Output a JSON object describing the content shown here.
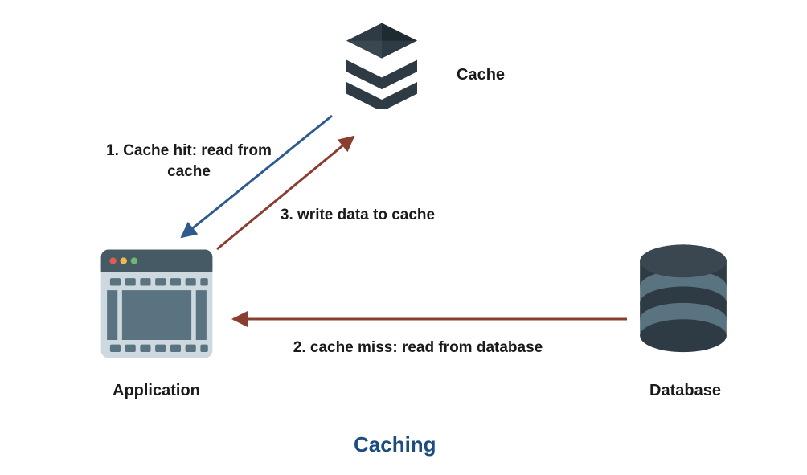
{
  "title": "Caching",
  "nodes": {
    "cache": {
      "label": "Cache"
    },
    "application": {
      "label": "Application"
    },
    "database": {
      "label": "Database"
    }
  },
  "edges": {
    "cache_hit": {
      "label": "1. Cache hit: read from\ncache"
    },
    "cache_miss": {
      "label": "2. cache miss: read from database"
    },
    "write_cache": {
      "label": "3. write data to cache"
    }
  },
  "colors": {
    "blue_arrow": "#2e5a8f",
    "brown_arrow": "#8b3e2f",
    "title": "#1a4d80",
    "dark": "#2f3b44",
    "steel": "#5a7380",
    "light": "#cdd9df"
  }
}
